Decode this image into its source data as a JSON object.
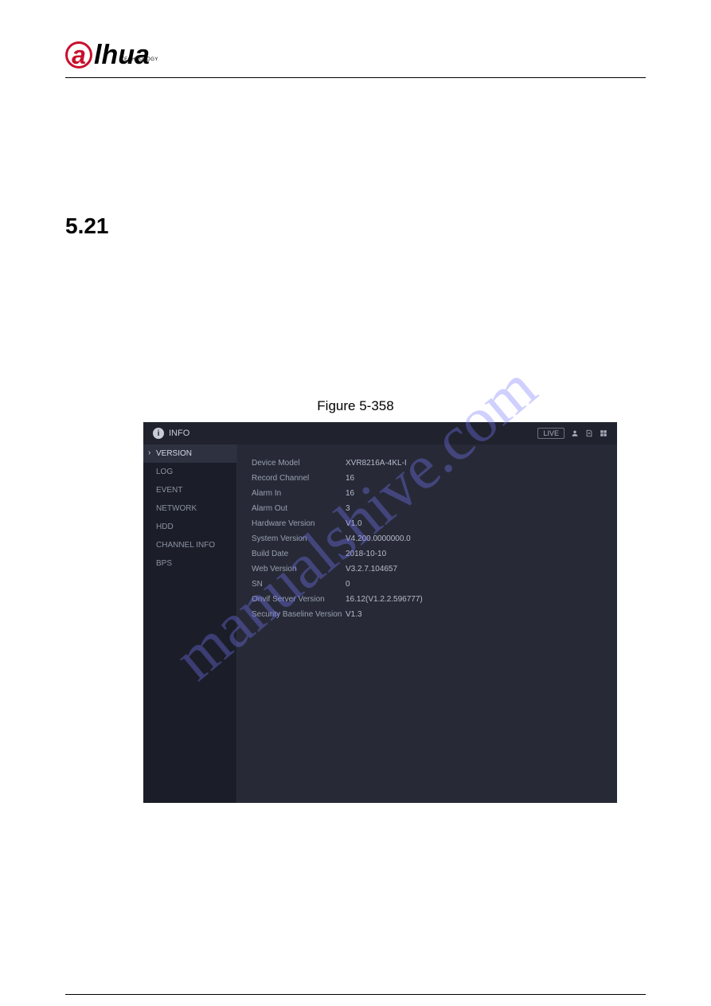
{
  "logo": {
    "text": "lhua",
    "sub": "TECHNOLOGY"
  },
  "section_number": "5.21",
  "figure_caption": "Figure 5-358",
  "watermark": "manualshive.com",
  "app": {
    "title": "INFO",
    "live_badge": "LIVE",
    "sidebar": [
      {
        "label": "VERSION",
        "active": true
      },
      {
        "label": "LOG",
        "active": false
      },
      {
        "label": "EVENT",
        "active": false
      },
      {
        "label": "NETWORK",
        "active": false
      },
      {
        "label": "HDD",
        "active": false
      },
      {
        "label": "CHANNEL INFO",
        "active": false
      },
      {
        "label": "BPS",
        "active": false
      }
    ],
    "rows": [
      {
        "label": "Device Model",
        "value": "XVR8216A-4KL-I"
      },
      {
        "label": "Record Channel",
        "value": "16"
      },
      {
        "label": "Alarm In",
        "value": "16"
      },
      {
        "label": "Alarm Out",
        "value": "3"
      },
      {
        "label": "Hardware Version",
        "value": "V1.0"
      },
      {
        "label": "System Version",
        "value": "V4.200.0000000.0"
      },
      {
        "label": "Build Date",
        "value": "2018-10-10"
      },
      {
        "label": "Web Version",
        "value": "V3.2.7.104657"
      },
      {
        "label": "SN",
        "value": "0"
      },
      {
        "label": "Onvif Server Version",
        "value": "16.12(V1.2.2.596777)"
      },
      {
        "label": "Security Baseline Version",
        "value": "V1.3"
      }
    ]
  }
}
